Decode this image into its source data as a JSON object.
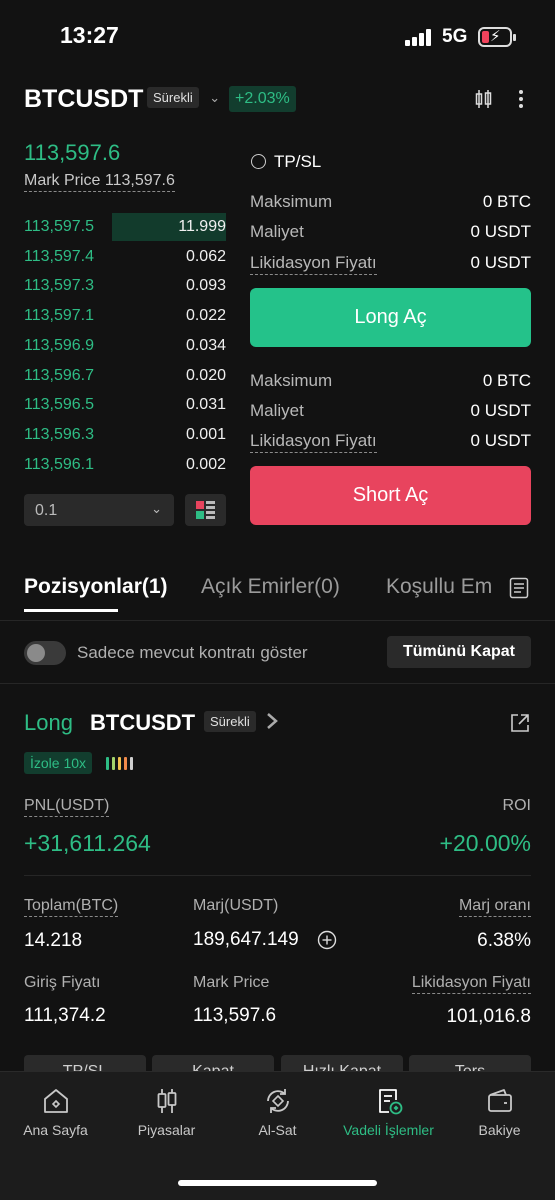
{
  "status_bar": {
    "time": "13:27",
    "network": "5G"
  },
  "header": {
    "symbol": "BTCUSDT",
    "contract_type": "Sürekli",
    "change_pct": "+2.03%"
  },
  "order_book": {
    "last_price": "113,597.6",
    "mark_price_label": "Mark Price",
    "mark_price": "113,597.6",
    "rows": [
      {
        "price": "113,597.5",
        "qty": "11.999",
        "depth": 1.0
      },
      {
        "price": "113,597.4",
        "qty": "0.062",
        "depth": 0.0
      },
      {
        "price": "113,597.3",
        "qty": "0.093",
        "depth": 0.0
      },
      {
        "price": "113,597.1",
        "qty": "0.022",
        "depth": 0.0
      },
      {
        "price": "113,596.9",
        "qty": "0.034",
        "depth": 0.0
      },
      {
        "price": "113,596.7",
        "qty": "0.020",
        "depth": 0.0
      },
      {
        "price": "113,596.5",
        "qty": "0.031",
        "depth": 0.0
      },
      {
        "price": "113,596.3",
        "qty": "0.001",
        "depth": 0.0
      },
      {
        "price": "113,596.1",
        "qty": "0.002",
        "depth": 0.0
      }
    ],
    "precision": "0.1"
  },
  "order_panel": {
    "tpsl_label": "TP/SL",
    "long": {
      "max_label": "Maksimum",
      "max_value": "0 BTC",
      "cost_label": "Maliyet",
      "cost_value": "0 USDT",
      "liq_label": "Likidasyon Fiyatı",
      "liq_value": "0 USDT",
      "button": "Long Aç"
    },
    "short": {
      "max_label": "Maksimum",
      "max_value": "0 BTC",
      "cost_label": "Maliyet",
      "cost_value": "0 USDT",
      "liq_label": "Likidasyon Fiyatı",
      "liq_value": "0 USDT",
      "button": "Short Aç"
    }
  },
  "tabs": {
    "positions": "Pozisyonlar(1)",
    "open_orders": "Açık Emirler(0)",
    "conditional": "Koşullu Em"
  },
  "filter": {
    "toggle_label": "Sadece mevcut kontratı göster",
    "close_all": "Tümünü Kapat"
  },
  "position": {
    "side": "Long",
    "symbol": "BTCUSDT",
    "contract_type": "Sürekli",
    "margin_mode": "İzole 10x",
    "pnl_label": "PNL(USDT)",
    "pnl_value": "+31,611.264",
    "roi_label": "ROI",
    "roi_value": "+20.00%",
    "total_label": "Toplam(BTC)",
    "total_value": "14.218",
    "margin_label": "Marj(USDT)",
    "margin_value": "189,647.149",
    "margin_ratio_label": "Marj oranı",
    "margin_ratio_value": "6.38%",
    "entry_label": "Giriş Fiyatı",
    "entry_value": "111,374.2",
    "mark_label": "Mark Price",
    "mark_value": "113,597.6",
    "liq_label": "Likidasyon Fiyatı",
    "liq_value": "101,016.8",
    "action_buttons": [
      "TP/SL",
      "Kapat",
      "Hızlı Kapat",
      "Ters"
    ]
  },
  "bottom_nav": [
    {
      "label": "Ana Sayfa",
      "icon": "home-icon"
    },
    {
      "label": "Piyasalar",
      "icon": "candles-icon"
    },
    {
      "label": "Al-Sat",
      "icon": "trade-icon"
    },
    {
      "label": "Vadeli İşlemler",
      "icon": "futures-icon",
      "active": true
    },
    {
      "label": "Bakiye",
      "icon": "wallet-icon"
    }
  ],
  "colors": {
    "green": "#2ebd85",
    "red": "#e8445e",
    "background": "#121212"
  }
}
